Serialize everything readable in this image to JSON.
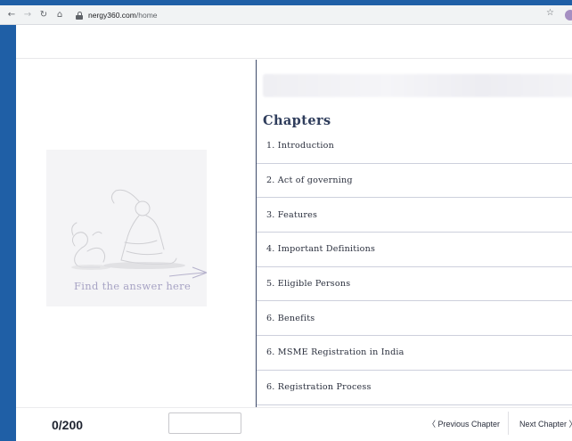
{
  "browser": {
    "back_icon": "←",
    "forward_icon": "→",
    "reload_icon": "↻",
    "home_icon": "⌂",
    "url_host": "nergy360.com",
    "url_path": "/home",
    "star_icon": "☆"
  },
  "illustration": {
    "caption": "Find the answer here"
  },
  "chapters": {
    "title": "Chapters",
    "items": [
      {
        "label": "1. Introduction"
      },
      {
        "label": "2. Act of governing"
      },
      {
        "label": "3. Features"
      },
      {
        "label": "4. Important Definitions"
      },
      {
        "label": "5. Eligible Persons"
      },
      {
        "label": "6. Benefits"
      },
      {
        "label": "6. MSME Registration in India"
      },
      {
        "label": "6. Registration Process"
      }
    ]
  },
  "footer": {
    "score": "0/200",
    "answer_value": "",
    "prev_label": "〈 Previous Chapter",
    "next_label": "Next Chapter 〉"
  },
  "colors": {
    "frame_blue": "#1f5fa6",
    "heading_navy": "#2f3d5c",
    "caption_lavender": "#a7a3c4"
  }
}
